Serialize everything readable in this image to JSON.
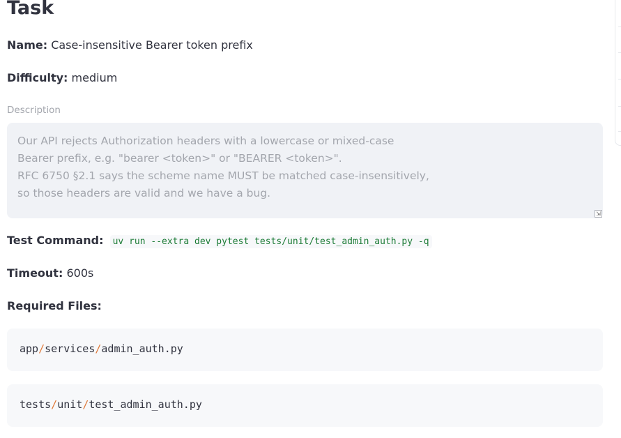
{
  "page": {
    "title": "Task"
  },
  "task": {
    "name_label": "Name:",
    "name_value": "Case-insensitive Bearer token prefix",
    "difficulty_label": "Difficulty:",
    "difficulty_value": "medium",
    "description_label": "Description",
    "description_lines": [
      "Our API rejects Authorization headers with a lowercase or mixed-case",
      "Bearer prefix, e.g. \"bearer <token>\" or \"BEARER <token>\".",
      "RFC 6750 §2.1 says the scheme name MUST be matched case-insensitively,",
      "so those headers are valid and we have a bug."
    ],
    "test_command_label": "Test Command:",
    "test_command_value": "uv run --extra dev pytest tests/unit/test_admin_auth.py -q",
    "timeout_label": "Timeout:",
    "timeout_value": "600s",
    "required_files_label": "Required Files:",
    "required_files": [
      {
        "parts": [
          "app",
          "services",
          "admin_auth.py"
        ]
      },
      {
        "parts": [
          "tests",
          "unit",
          "test_admin_auth.py"
        ]
      }
    ]
  },
  "icons": {
    "resize_handle": "resize-handle-icon"
  }
}
